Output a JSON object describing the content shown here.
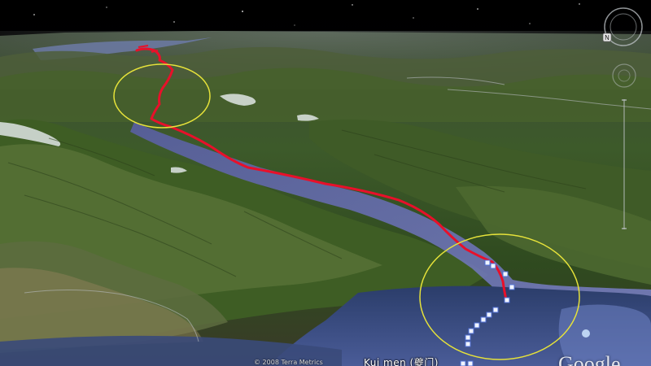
{
  "map": {
    "place_label": "Kui men (夔门)",
    "copyright": "© 2008 Terra Metrics",
    "brand": "Google",
    "compass_north": "N"
  },
  "colors": {
    "route": "#e8102a",
    "highlight_ring": "#e6e23a",
    "waypoint_fill": "#f0f4ff",
    "waypoint_stroke": "#4f6fd6",
    "river": "#6a6fb8",
    "sky": "#000000"
  },
  "icons": {
    "compass": "compass-ring-icon",
    "look": "look-around-icon",
    "zoom": "zoom-slider-icon"
  }
}
